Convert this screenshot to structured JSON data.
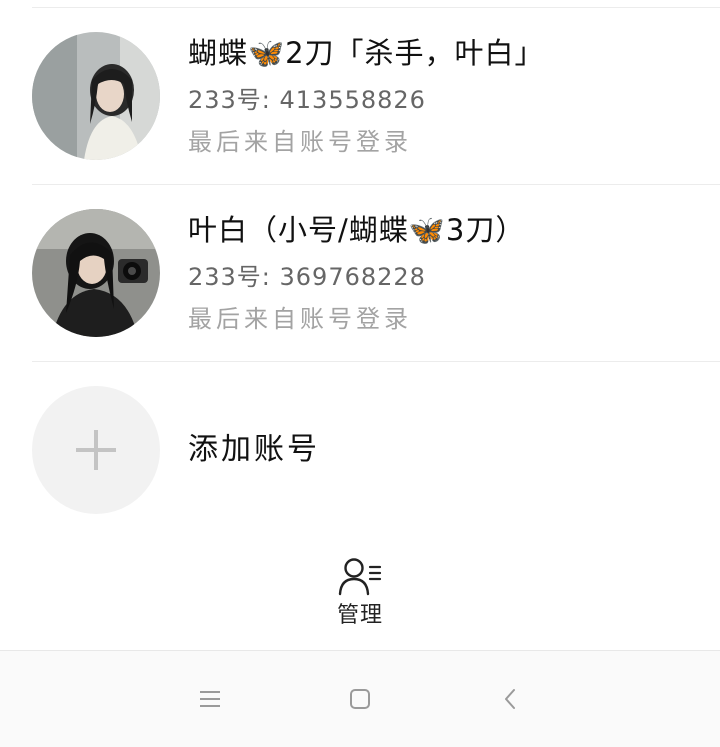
{
  "accounts": [
    {
      "name": "蝴蝶🦋2刀「杀手，叶白」",
      "uid": "233号: 413558826",
      "last_login": "最后来自账号登录"
    },
    {
      "name": "叶白（小号/蝴蝶🦋3刀）",
      "uid": "233号: 369768228",
      "last_login": "最后来自账号登录"
    }
  ],
  "add_account": {
    "label": "添加账号"
  },
  "manage": {
    "label": "管理",
    "icon": "user-manage-icon"
  },
  "nav": {
    "menu_icon": "menu-icon",
    "home_icon": "home-icon",
    "back_icon": "back-icon"
  },
  "colors": {
    "divider": "#ececec",
    "secondary_text": "#666666",
    "muted_text": "#a3a3a3",
    "add_bg": "#f2f2f2"
  }
}
